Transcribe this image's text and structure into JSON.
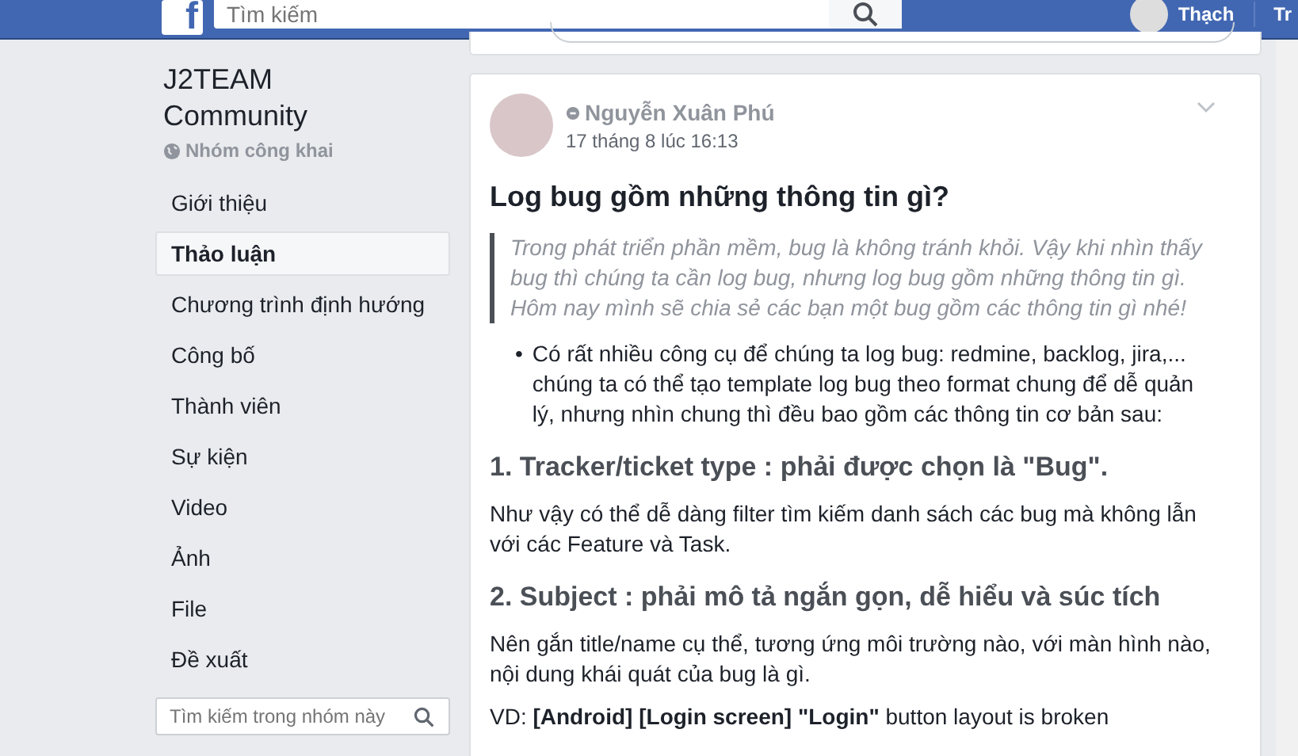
{
  "top_bar": {
    "logo": "f",
    "search": {
      "placeholder": "Tìm kiếm"
    },
    "user_name": "Thạch",
    "next_link": "Tr"
  },
  "group": {
    "name": "J2TEAM Community",
    "privacy": "Nhóm công khai"
  },
  "sidebar": {
    "items": [
      {
        "label": "Giới thiệu",
        "selected": false
      },
      {
        "label": "Thảo luận",
        "selected": true
      },
      {
        "label": "Chương trình định hướng",
        "selected": false
      },
      {
        "label": "Công bố",
        "selected": false
      },
      {
        "label": "Thành viên",
        "selected": false
      },
      {
        "label": "Sự kiện",
        "selected": false
      },
      {
        "label": "Video",
        "selected": false
      },
      {
        "label": "Ảnh",
        "selected": false
      },
      {
        "label": "File",
        "selected": false
      },
      {
        "label": "Đề xuất",
        "selected": false
      }
    ],
    "search": {
      "placeholder": "Tìm kiếm trong nhóm này"
    }
  },
  "post": {
    "author": "Nguyễn Xuân Phú",
    "time": "17 tháng 8 lúc 16:13",
    "title": "Log bug gồm những thông tin gì?",
    "quote": "Trong phát triển phần mềm, bug là không tránh khỏi. Vậy khi nhìn thấy bug thì chúng ta cần log bug, nhưng log bug gồm những thông tin gì. Hôm nay mình sẽ chia sẻ các bạn một bug gồm các thông tin gì nhé!",
    "blocks": [
      {
        "kind": "bullet",
        "marker": "•",
        "text": "Có rất nhiều công cụ để chúng ta log bug: redmine, backlog, jira,... chúng ta có thể tạo template log bug theo format chung để dễ quản lý, nhưng nhìn chung thì đều bao gồm các thông tin cơ bản sau:"
      },
      {
        "kind": "heading",
        "text": "1. Tracker/ticket type : phải được chọn là \"Bug\"."
      },
      {
        "kind": "paragraph",
        "text": "Như vậy có thể dễ dàng filter tìm kiếm danh sách các bug mà không lẫn với các Feature và Task."
      },
      {
        "kind": "heading",
        "text": "2. Subject : phải mô tả ngắn gọn, dễ hiểu và súc tích"
      },
      {
        "kind": "paragraph",
        "text": "Nên gắn title/name cụ thể, tương ứng môi trường nào, với màn hình nào, nội dung khái quát của bug là gì."
      },
      {
        "kind": "paragraph",
        "text": "VD: **[Android]** **[Login screen]** **\"Login\"** button layout is broken"
      }
    ]
  }
}
